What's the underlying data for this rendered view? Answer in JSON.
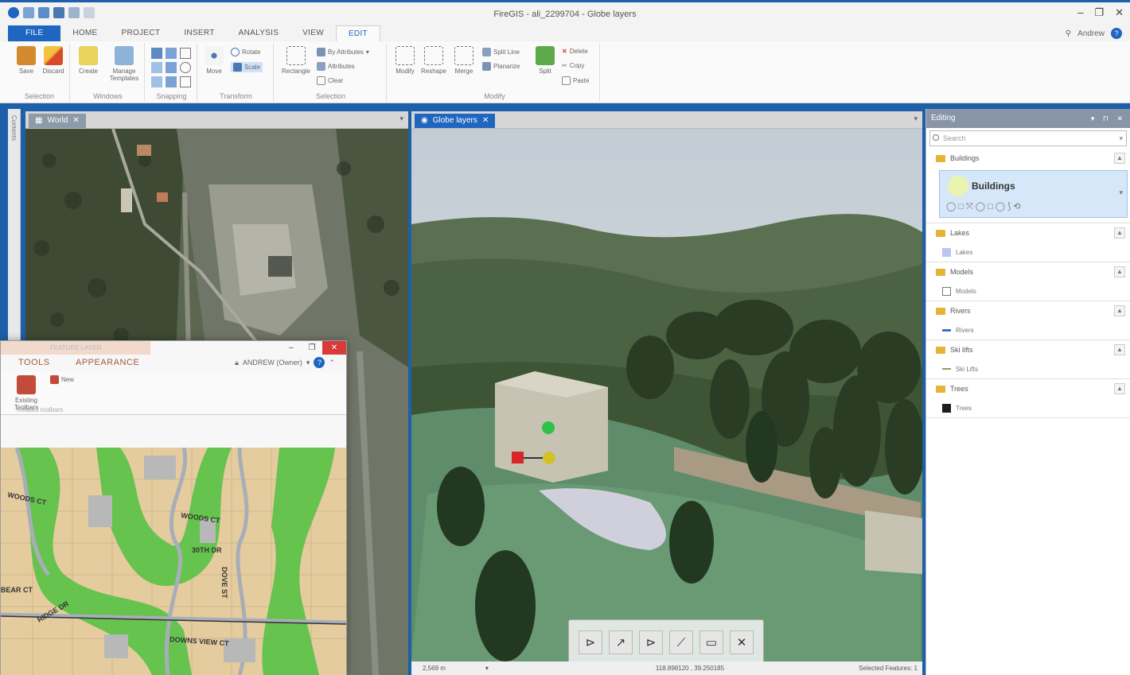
{
  "window": {
    "title": "FireGIS - ali_2299704 - Globe layers",
    "controls": [
      "–",
      "❐",
      "✕"
    ]
  },
  "ribbon": {
    "tabs": [
      "FILE",
      "HOME",
      "PROJECT",
      "INSERT",
      "ANALYSIS",
      "VIEW",
      "EDIT"
    ],
    "active_tab": "EDIT",
    "user_name": "Andrew",
    "help_label": "?",
    "groups": {
      "selection": {
        "label": "Selection",
        "buttons": [
          "Save",
          "Discard"
        ]
      },
      "windows": {
        "label": "Windows",
        "buttons": [
          "Create",
          "Manage Templates"
        ]
      },
      "snapping": {
        "label": "Snapping"
      },
      "transform": {
        "label": "Transform",
        "buttons": [
          "Move"
        ],
        "small": [
          "Rotate",
          "Scale"
        ]
      },
      "selection2": {
        "label": "Selection",
        "buttons": [
          "Rectangle"
        ],
        "small": [
          "By Attributes",
          "Attributes",
          "Clear"
        ]
      },
      "modify": {
        "label": "Modify",
        "buttons": [
          "Modify",
          "Reshape",
          "Merge",
          "Split"
        ],
        "small": [
          "Split Line",
          "Planarize",
          "Delete",
          "Copy",
          "Paste"
        ]
      }
    }
  },
  "left_strip": {
    "label": "Contents"
  },
  "world_view": {
    "tab_label": "World"
  },
  "globe_view": {
    "tab_label": "Globe layers",
    "scale": "2,569 m",
    "coordinates": "118.898120 , 39.250185",
    "selected_features": "Selected Features: 1",
    "toolbar_glyphs": [
      "⊳",
      "↗",
      "⊳",
      "⟋",
      "▭",
      "✕"
    ]
  },
  "editing_pane": {
    "title": "Editing",
    "header_controls": "▾ ⊓ ✕",
    "search_placeholder": "Search",
    "groups": [
      {
        "name": "Buildings",
        "symbol": "Buildings",
        "color": "#eaf3b0",
        "selected": true
      },
      {
        "name": "Lakes",
        "symbol": "Lakes",
        "color": "#b7c7f0"
      },
      {
        "name": "Models",
        "symbol": "Models",
        "color": "#ffffff"
      },
      {
        "name": "Rivers",
        "symbol": "Rivers",
        "color": "#3b73c4"
      },
      {
        "name": "Ski lifts",
        "symbol": "Ski Lifts",
        "color": "#8aa05a"
      },
      {
        "name": "Trees",
        "symbol": "Trees",
        "color": "#1d1d1d"
      }
    ],
    "card_tools": "◯□⤧◯□◯⟆⟲"
  },
  "floating_window": {
    "context_tab": "FEATURE LAYER",
    "tabs": [
      "TOOLS",
      "APPEARANCE"
    ],
    "user": "ANDREW (Owner)",
    "help_label": "?",
    "buttons": [
      "Existing Toolbars",
      "New"
    ],
    "group_label": "Related toolbars",
    "streets": [
      "WOODS CT",
      "WOODS CT",
      "BEAR CT",
      "RIDGE DR",
      "DOWNS VIEW CT",
      "DOVE ST",
      "30TH DR"
    ]
  },
  "colors": {
    "file_tab": "#1f66c0",
    "accent": "#1f66c0",
    "pane_header": "#8795a6",
    "close_red": "#d93a3a"
  }
}
